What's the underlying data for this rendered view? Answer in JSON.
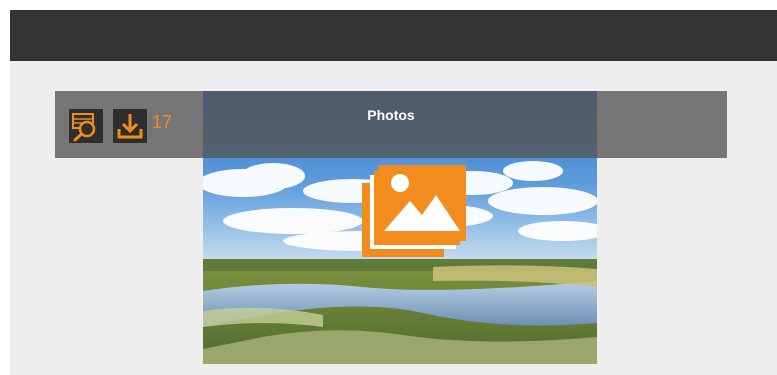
{
  "overlay": {
    "title": "Photos",
    "download_count": "17"
  },
  "icons": {
    "preview": "image-search-icon",
    "download": "download-icon",
    "badge": "photo-gallery-icon"
  },
  "colors": {
    "accent": "#F28C1C",
    "top_bar": "#333333",
    "background": "#EEEEEE",
    "overlay": "#555555"
  }
}
